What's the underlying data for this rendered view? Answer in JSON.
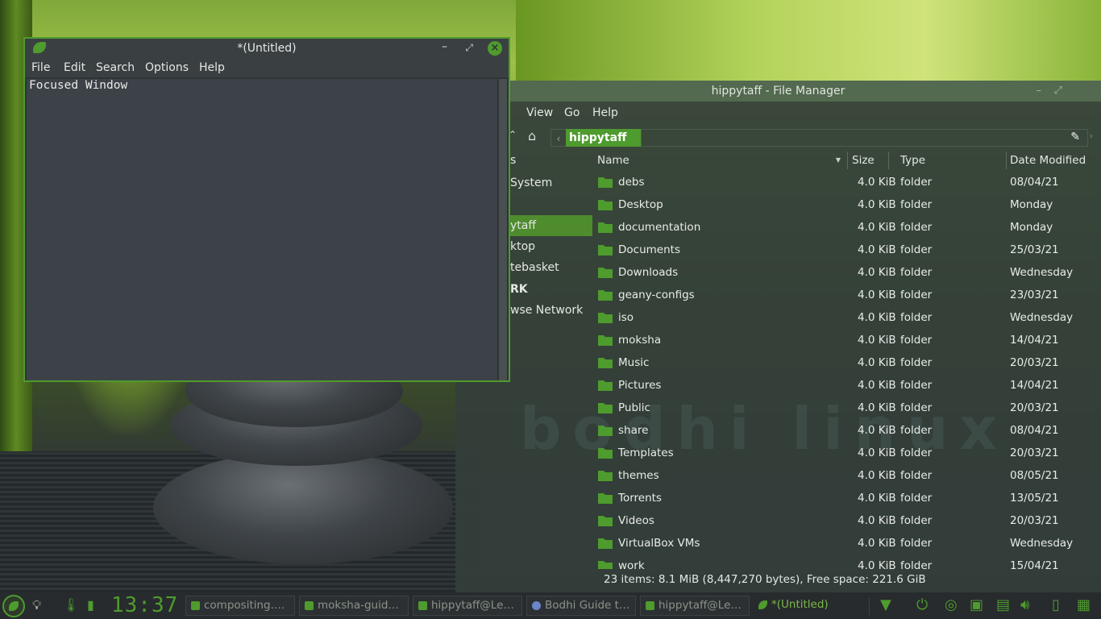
{
  "file_manager": {
    "title": "hippytaff - File Manager",
    "menu": [
      "t",
      "View",
      "Go",
      "Help"
    ],
    "path_button": "hippytaff",
    "sidebar": [
      {
        "label": "s",
        "selected": false,
        "bold": false
      },
      {
        "label": "System",
        "selected": false,
        "bold": false
      },
      {
        "label": "",
        "selected": false,
        "bold": false
      },
      {
        "label": "ytaff",
        "selected": true,
        "bold": false
      },
      {
        "label": "ktop",
        "selected": false,
        "bold": false
      },
      {
        "label": "tebasket",
        "selected": false,
        "bold": false
      },
      {
        "label": "RK",
        "selected": false,
        "bold": true
      },
      {
        "label": "wse Network",
        "selected": false,
        "bold": false
      }
    ],
    "columns": {
      "name": "Name",
      "size": "Size",
      "type": "Type",
      "date": "Date Modified"
    },
    "files": [
      {
        "name": "debs",
        "size": "4.0 KiB",
        "type": "folder",
        "date": "08/04/21",
        "icon": "folder-icon"
      },
      {
        "name": "Desktop",
        "size": "4.0 KiB",
        "type": "folder",
        "date": "Monday",
        "icon": "desktop-folder-icon"
      },
      {
        "name": "documentation",
        "size": "4.0 KiB",
        "type": "folder",
        "date": "Monday",
        "icon": "folder-icon"
      },
      {
        "name": "Documents",
        "size": "4.0 KiB",
        "type": "folder",
        "date": "25/03/21",
        "icon": "documents-folder-icon"
      },
      {
        "name": "Downloads",
        "size": "4.0 KiB",
        "type": "folder",
        "date": "Wednesday",
        "icon": "downloads-folder-icon"
      },
      {
        "name": "geany-configs",
        "size": "4.0 KiB",
        "type": "folder",
        "date": "23/03/21",
        "icon": "folder-icon"
      },
      {
        "name": "iso",
        "size": "4.0 KiB",
        "type": "folder",
        "date": "Wednesday",
        "icon": "folder-icon"
      },
      {
        "name": "moksha",
        "size": "4.0 KiB",
        "type": "folder",
        "date": "14/04/21",
        "icon": "folder-icon"
      },
      {
        "name": "Music",
        "size": "4.0 KiB",
        "type": "folder",
        "date": "20/03/21",
        "icon": "music-folder-icon"
      },
      {
        "name": "Pictures",
        "size": "4.0 KiB",
        "type": "folder",
        "date": "14/04/21",
        "icon": "pictures-folder-icon"
      },
      {
        "name": "Public",
        "size": "4.0 KiB",
        "type": "folder",
        "date": "20/03/21",
        "icon": "public-folder-icon"
      },
      {
        "name": "share",
        "size": "4.0 KiB",
        "type": "folder",
        "date": "08/04/21",
        "icon": "folder-icon"
      },
      {
        "name": "Templates",
        "size": "4.0 KiB",
        "type": "folder",
        "date": "20/03/21",
        "icon": "templates-folder-icon"
      },
      {
        "name": "themes",
        "size": "4.0 KiB",
        "type": "folder",
        "date": "08/05/21",
        "icon": "folder-icon"
      },
      {
        "name": "Torrents",
        "size": "4.0 KiB",
        "type": "folder",
        "date": "13/05/21",
        "icon": "folder-icon"
      },
      {
        "name": "Videos",
        "size": "4.0 KiB",
        "type": "folder",
        "date": "20/03/21",
        "icon": "videos-folder-icon"
      },
      {
        "name": "VirtualBox VMs",
        "size": "4.0 KiB",
        "type": "folder",
        "date": "Wednesday",
        "icon": "folder-icon"
      },
      {
        "name": "work",
        "size": "4.0 KiB",
        "type": "folder",
        "date": "15/04/21",
        "icon": "folder-icon"
      }
    ],
    "status": "23 items: 8.1 MiB (8,447,270 bytes), Free space: 221.6 GiB"
  },
  "editor": {
    "title": "*(Untitled)",
    "menu": [
      "File",
      "Edit",
      "Search",
      "Options",
      "Help"
    ],
    "content": "Focused Window"
  },
  "taskbar": {
    "clock": "13:37",
    "tasks": [
      {
        "label": "compositing.…",
        "icon": "leafpad"
      },
      {
        "label": "moksha-guid…",
        "icon": "leafpad"
      },
      {
        "label": "hippytaff@Le…",
        "icon": "terminal"
      },
      {
        "label": "Bodhi Guide t…",
        "icon": "chrome"
      },
      {
        "label": "hippytaff@Le…",
        "icon": "terminal"
      },
      {
        "label": "*(Untitled)",
        "icon": "leaf",
        "active": true
      }
    ]
  },
  "wallpaper_text": "bodhi linux",
  "colors": {
    "accent": "#4e9b2e",
    "selection": "#4e8c2e"
  }
}
